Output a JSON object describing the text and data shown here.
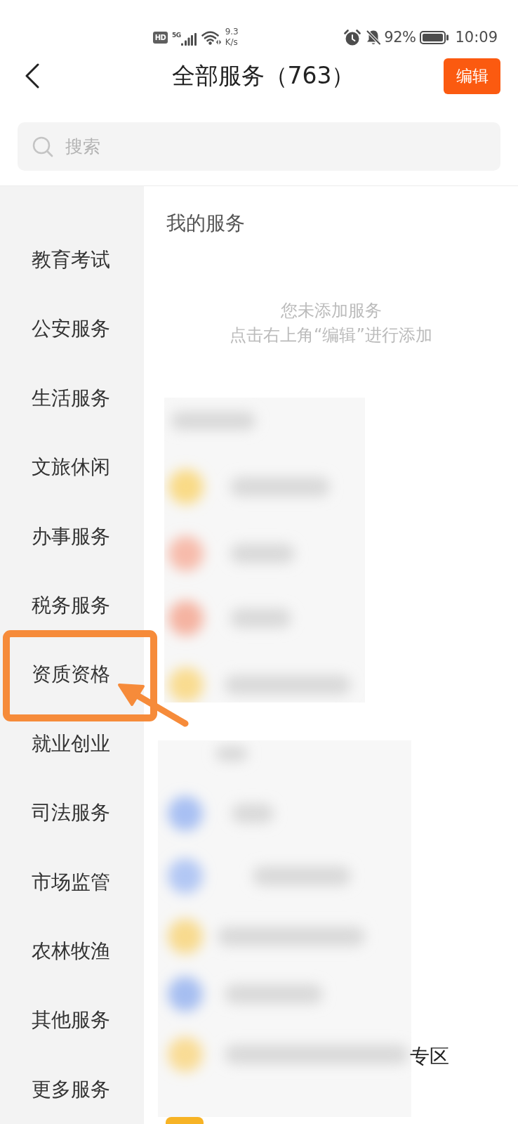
{
  "status_bar": {
    "hd_badge": "HD",
    "network": "5G",
    "speed": "9.3",
    "speed_unit": "K/s",
    "battery": "92%",
    "time": "10:09"
  },
  "header": {
    "title": "全部服务（763）",
    "edit_button": "编辑"
  },
  "search": {
    "placeholder": "搜索"
  },
  "sidebar": {
    "items": [
      {
        "label": "教育考试",
        "highlighted": false
      },
      {
        "label": "公安服务",
        "highlighted": false
      },
      {
        "label": "生活服务",
        "highlighted": false
      },
      {
        "label": "文旅休闲",
        "highlighted": false
      },
      {
        "label": "办事服务",
        "highlighted": false
      },
      {
        "label": "税务服务",
        "highlighted": false
      },
      {
        "label": "资质资格",
        "highlighted": true
      },
      {
        "label": "就业创业",
        "highlighted": false
      },
      {
        "label": "司法服务",
        "highlighted": false
      },
      {
        "label": "市场监管",
        "highlighted": false
      },
      {
        "label": "农林牧渔",
        "highlighted": false
      },
      {
        "label": "其他服务",
        "highlighted": false
      },
      {
        "label": "更多服务",
        "highlighted": false
      }
    ]
  },
  "content": {
    "sections": [
      {
        "kind": "my_services",
        "title": "我的服务",
        "empty_message": [
          "您未添加服务",
          "点击右上角“编辑”进行添加"
        ]
      },
      {
        "kind": "blurred"
      },
      {
        "kind": "blurred",
        "trailing_text": "专区"
      },
      {
        "kind": "service_row"
      }
    ]
  }
}
